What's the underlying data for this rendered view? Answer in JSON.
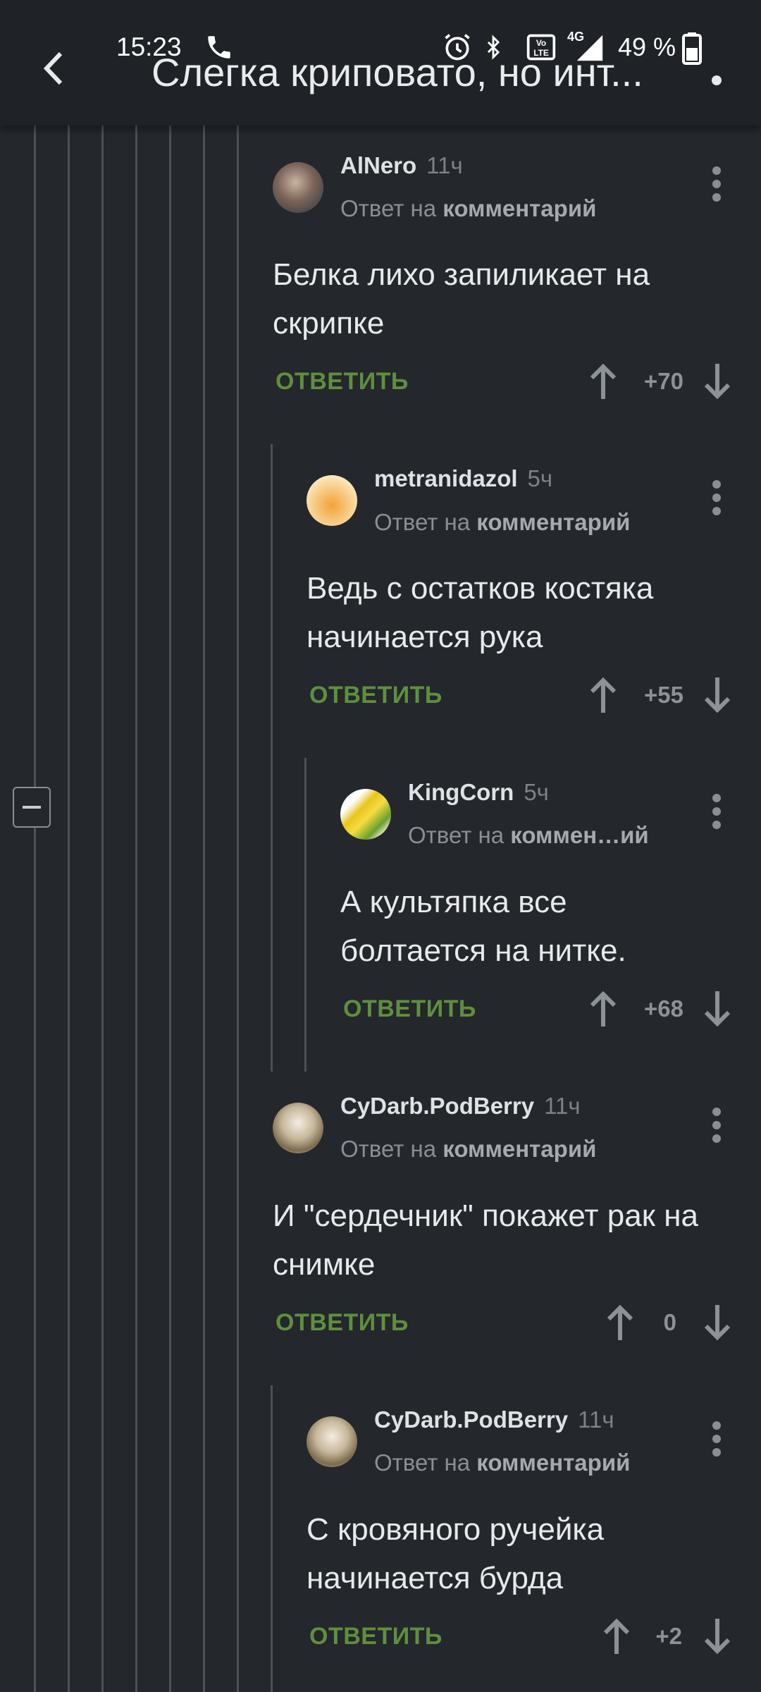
{
  "status_bar": {
    "time": "15:23",
    "battery": "49 %",
    "network": "4G"
  },
  "header": {
    "title": "Слегка криповато, но инт..."
  },
  "comments": [
    {
      "user": "AlNero",
      "time": "11ч",
      "reply_prefix": "Ответ на",
      "reply_target": "комментарий",
      "text": "Белка лихо запиликает на скрипке",
      "reply_label": "ОТВЕТИТЬ",
      "score": "+70"
    },
    {
      "user": "metranidazol",
      "time": "5ч",
      "reply_prefix": "Ответ на",
      "reply_target": "комментарий",
      "text": "Ведь с остатков костяка начинается рука",
      "reply_label": "ОТВЕТИТЬ",
      "score": "+55"
    },
    {
      "user": "KingCorn",
      "time": "5ч",
      "reply_prefix": "Ответ на",
      "reply_target": "коммен…ий",
      "text": "А культяпка все болтается на нитке.",
      "reply_label": "ОТВЕТИТЬ",
      "score": "+68"
    },
    {
      "user": "CyDarb.PodBerry",
      "time": "11ч",
      "reply_prefix": "Ответ на",
      "reply_target": "комментарий",
      "text": "И \"сердечник\" покажет рак на снимке",
      "reply_label": "ОТВЕТИТЬ",
      "score": "0"
    },
    {
      "user": "CyDarb.PodBerry",
      "time": "11ч",
      "reply_prefix": "Ответ на",
      "reply_target": "комментарий",
      "text": "С кровяного ручейка начинается бурда",
      "reply_label": "ОТВЕТИТЬ",
      "score": "+2"
    }
  ],
  "colors": {
    "background": "#24272b",
    "reply_green": "#5e8f3f",
    "thread_line": "#4d5156"
  }
}
